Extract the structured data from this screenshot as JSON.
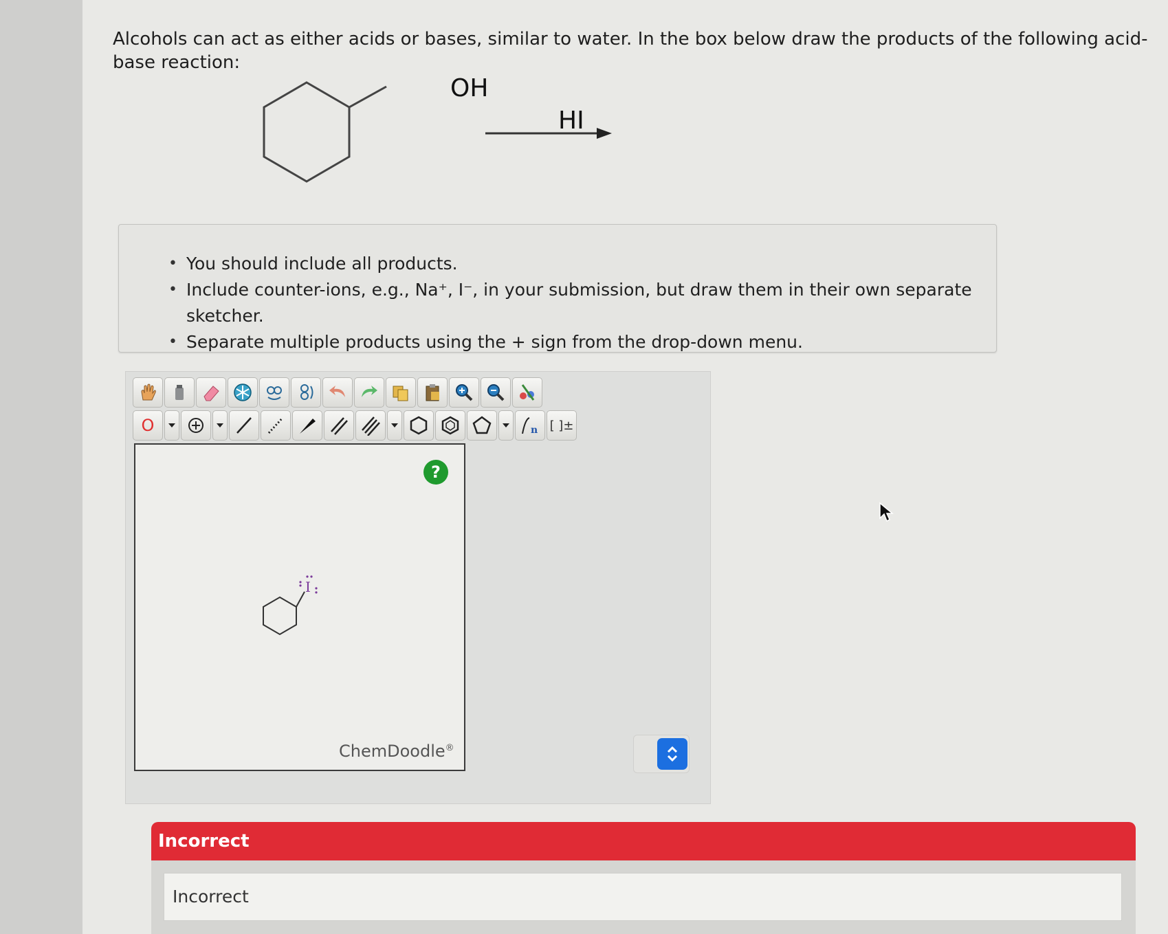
{
  "question": {
    "text": "Alcohols can act as either acids or bases, similar to water. In the box below draw the products of the following acid-base reaction:"
  },
  "reaction": {
    "reactant_group": "OH",
    "reagent": "HI"
  },
  "instructions": {
    "items": [
      "You should include all products.",
      "Include counter-ions, e.g., Na⁺, I⁻, in your submission, but draw them in their own separate sketcher.",
      "Separate multiple products using the + sign from the drop-down menu."
    ]
  },
  "sketcher": {
    "element_label": "O",
    "brand": "ChemDoodle",
    "brand_mark": "®",
    "help_label": "?",
    "drawn_atom_label": "I",
    "bracket_label": "[ ]±",
    "accent_color": "#1f9a2e"
  },
  "feedback": {
    "header": "Incorrect",
    "message": "Incorrect",
    "header_color": "#e02b35"
  }
}
